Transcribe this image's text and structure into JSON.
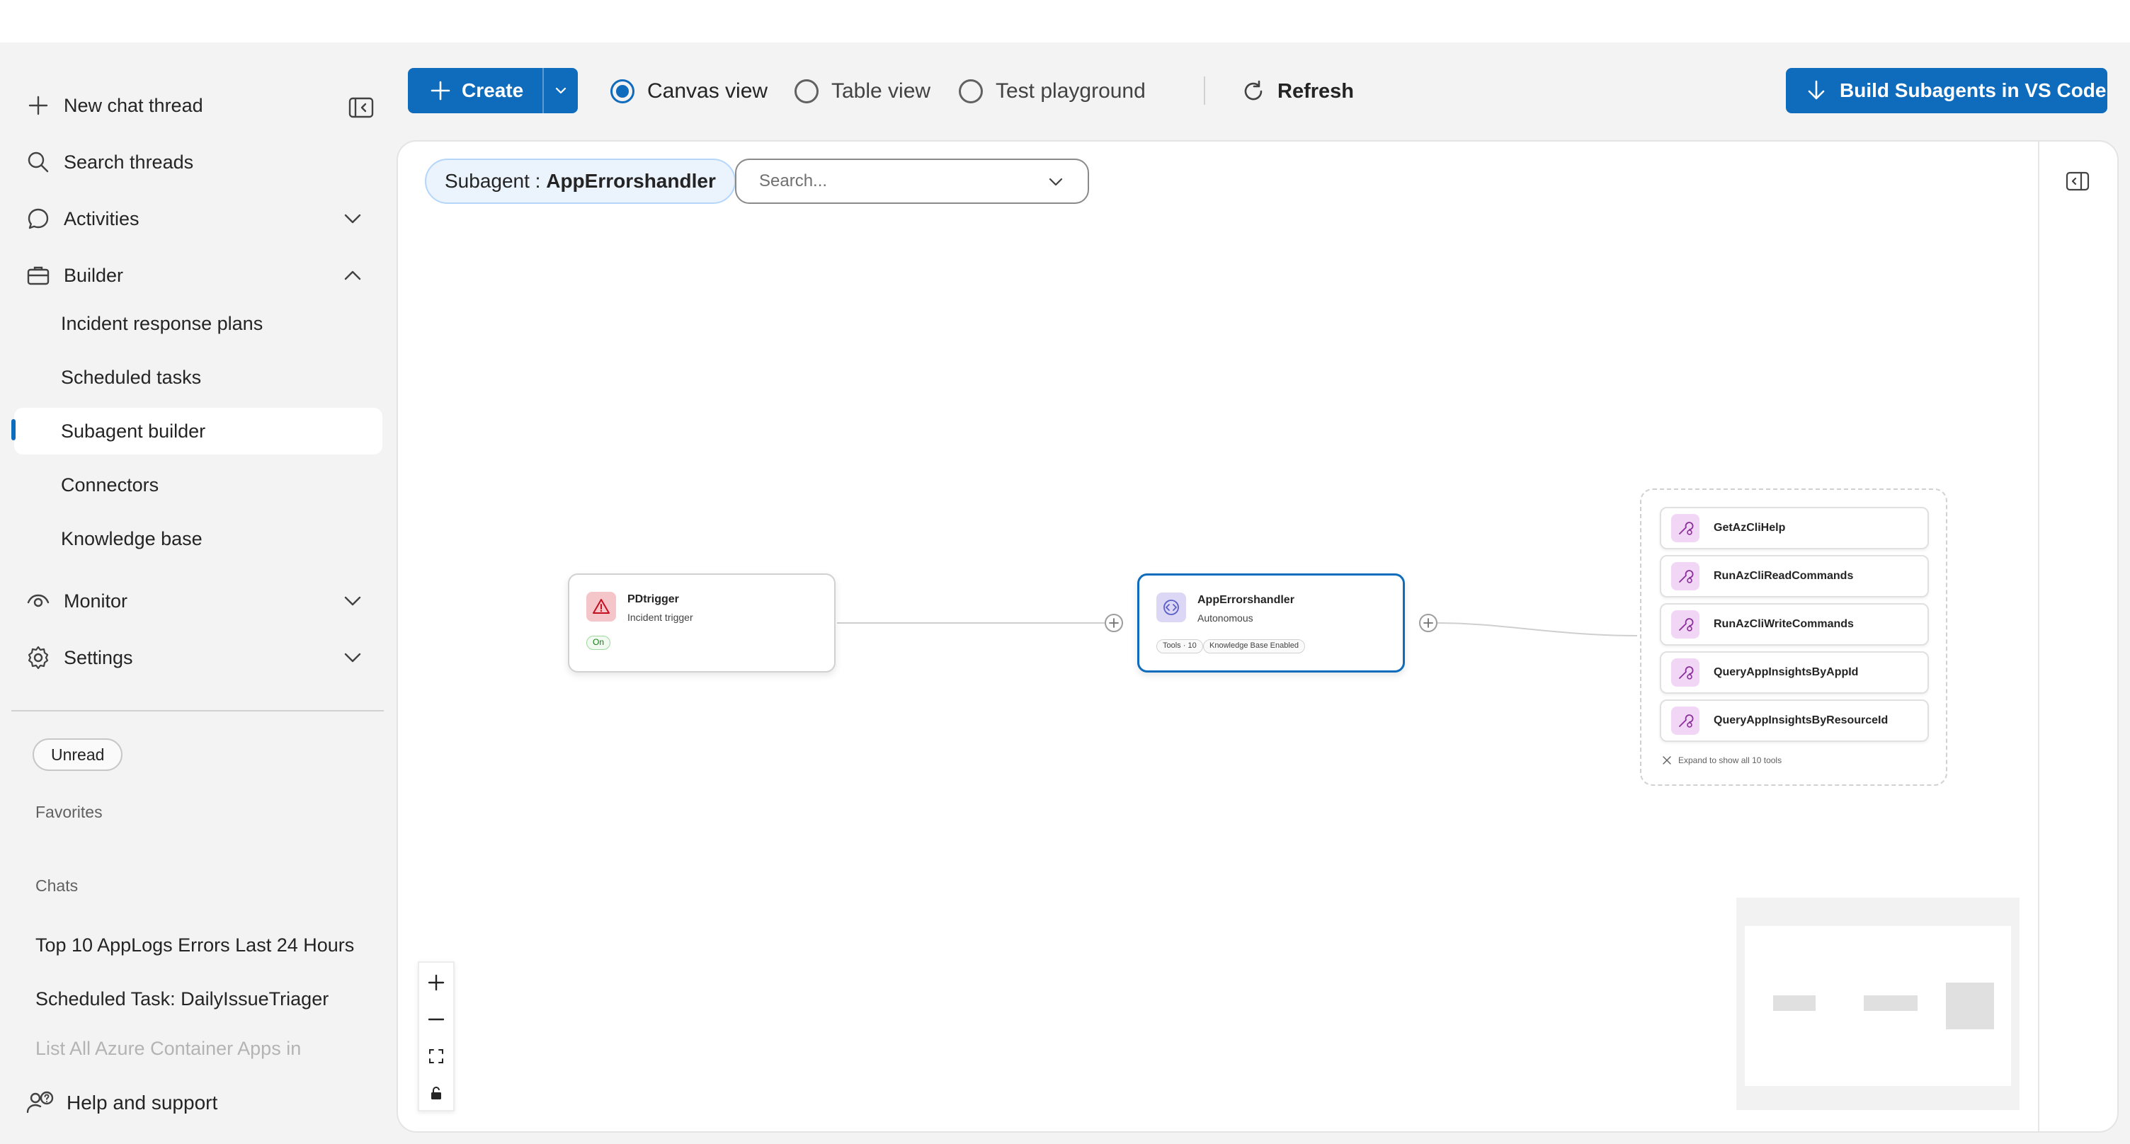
{
  "sidebar": {
    "new_chat": "New chat thread",
    "search_threads": "Search threads",
    "activities": "Activities",
    "builder": "Builder",
    "builder_items": [
      "Incident response plans",
      "Scheduled tasks",
      "Subagent builder",
      "Connectors",
      "Knowledge base"
    ],
    "active_item": "Subagent builder",
    "monitor": "Monitor",
    "settings": "Settings",
    "filter_unread": "Unread",
    "favorites_label": "Favorites",
    "chats_label": "Chats",
    "chats": [
      "Top 10 AppLogs Errors Last 24 Hours",
      "Scheduled Task: DailyIssueTriager",
      "List All Azure Container Apps in"
    ],
    "help": "Help and support"
  },
  "toolbar": {
    "create": "Create",
    "views": [
      "Canvas view",
      "Table view",
      "Test playground"
    ],
    "selected_view": "Canvas view",
    "refresh": "Refresh",
    "build_button": "Build Subagents in VS Code",
    "accent": "#0f6cbd"
  },
  "canvas": {
    "chip_prefix": "Subagent : ",
    "chip_value": "AppErrorshandler",
    "search_placeholder": "Search...",
    "trigger_node": {
      "title": "PDtrigger",
      "subtitle": "Incident trigger",
      "status": "On",
      "icon": "warning-icon"
    },
    "agent_node": {
      "title": "AppErrorshandler",
      "subtitle": "Autonomous",
      "tags": [
        "Tools · 10",
        "Knowledge Base Enabled"
      ],
      "icon": "code-icon"
    },
    "tools": [
      "GetAzCliHelp",
      "RunAzCliReadCommands",
      "RunAzCliWriteCommands",
      "QueryAppInsightsByAppId",
      "QueryAppInsightsByResourceId"
    ],
    "expand_label": "Expand to show all 10 tools"
  }
}
